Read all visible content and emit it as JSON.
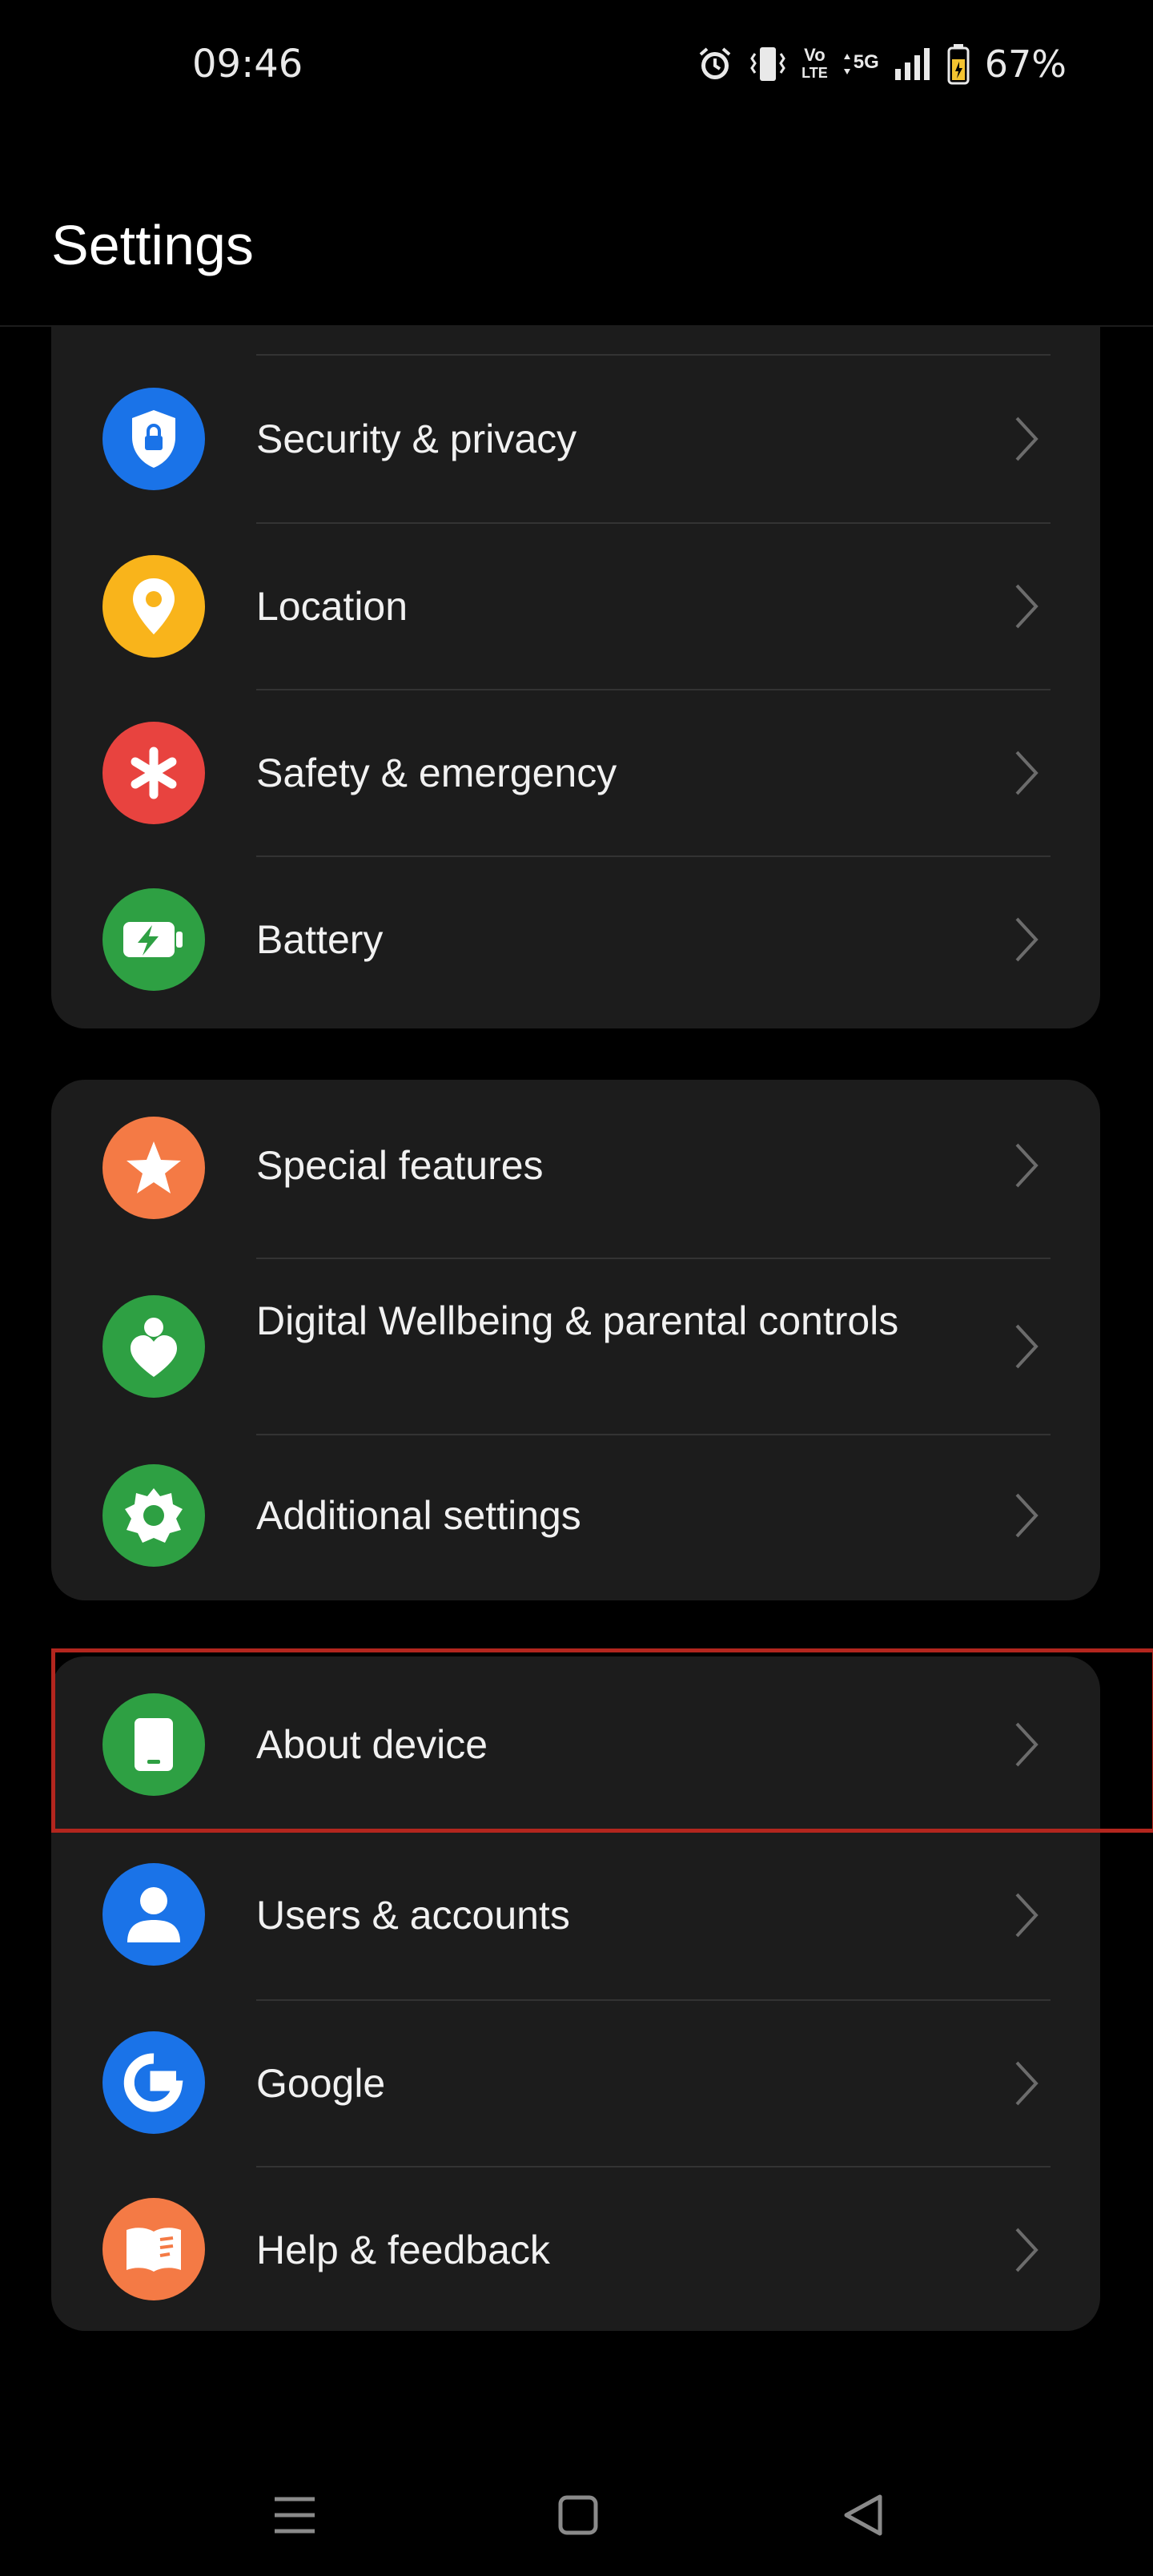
{
  "status_bar": {
    "time": "09:46",
    "battery_percent": "67%",
    "icons": [
      "alarm-icon",
      "vibrate-icon",
      "volte-icon",
      "5g-icon",
      "signal-icon",
      "battery-icon"
    ],
    "network_label": "5G",
    "volte_label_top": "Vo",
    "volte_label_bottom": "LTE"
  },
  "header": {
    "title": "Settings"
  },
  "groups": [
    {
      "items": [
        {
          "label": "Security & privacy",
          "icon": "shield-lock-icon",
          "color": "#1a73e8"
        },
        {
          "label": "Location",
          "icon": "location-pin-icon",
          "color": "#f9b41b"
        },
        {
          "label": "Safety & emergency",
          "icon": "asterisk-icon",
          "color": "#e8433f"
        },
        {
          "label": "Battery",
          "icon": "battery-bolt-icon",
          "color": "#2ea043"
        }
      ]
    },
    {
      "items": [
        {
          "label": "Special features",
          "icon": "star-icon",
          "color": "#f47a45"
        },
        {
          "label": "Digital Wellbeing & parental controls",
          "icon": "wellbeing-icon",
          "color": "#2ea043"
        },
        {
          "label": "Additional settings",
          "icon": "gear-icon",
          "color": "#2ea043"
        }
      ]
    },
    {
      "items": [
        {
          "label": "About device",
          "icon": "phone-device-icon",
          "color": "#2ea043"
        },
        {
          "label": "Users & accounts",
          "icon": "user-icon",
          "color": "#1a73e8"
        },
        {
          "label": "Google",
          "icon": "google-icon",
          "color": "#1a73e8"
        },
        {
          "label": "Help & feedback",
          "icon": "book-icon",
          "color": "#f47a45"
        }
      ]
    }
  ],
  "nav_bar": {
    "buttons": [
      "menu-icon",
      "home-icon",
      "back-icon"
    ]
  },
  "accent": {
    "highlight": "#b3261e",
    "card_bg": "#1c1c1c"
  }
}
